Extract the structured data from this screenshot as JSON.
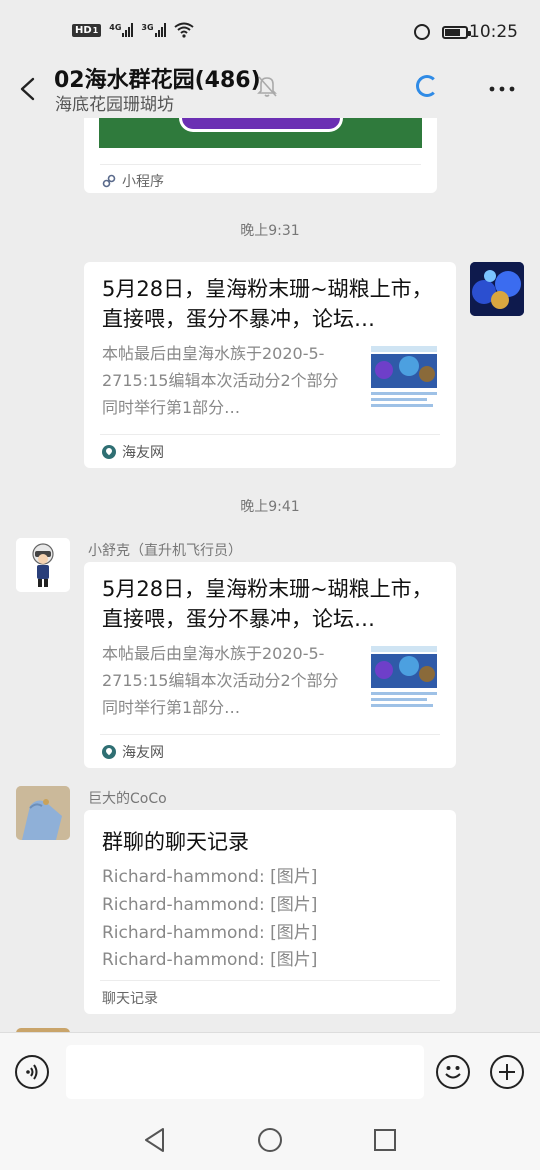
{
  "status_bar": {
    "hd_label": "HD",
    "hd_sub": "1",
    "sig1_label": "4G",
    "sig2_label": "3G",
    "battery_percent": 75,
    "time": "10:25"
  },
  "header": {
    "title": "02海水群花园(486)",
    "subtitle": "海底花园珊瑚坊"
  },
  "messages": [
    {
      "type": "mini-program-tail",
      "source": "小程序"
    },
    {
      "type": "timestamp",
      "text": "晚上9:31"
    },
    {
      "type": "link",
      "side": "right",
      "title": "5月28日，皇海粉末珊~瑚粮上市，直接喂，蛋分不暴冲，论坛…",
      "desc": "本帖最后由皇海水族于2020-5-2715:15编辑本次活动分2个部分同时举行第1部分…",
      "source": "海友网"
    },
    {
      "type": "timestamp",
      "text": "晚上9:41"
    },
    {
      "type": "link",
      "side": "left",
      "sender": "小舒克（直升机飞行员）",
      "title": "5月28日，皇海粉末珊~瑚粮上市，直接喂，蛋分不暴冲，论坛…",
      "desc": "本帖最后由皇海水族于2020-5-2715:15编辑本次活动分2个部分同时举行第1部分…",
      "source": "海友网"
    },
    {
      "type": "chat-record",
      "side": "left",
      "sender": "巨大的CoCo",
      "title": "群聊的聊天记录",
      "lines": [
        "Richard-hammond: [图片]",
        "Richard-hammond: [图片]",
        "Richard-hammond: [图片]",
        "Richard-hammond: [图片]"
      ],
      "footer": "聊天记录"
    }
  ],
  "input": {
    "placeholder": ""
  },
  "colors": {
    "accent": "#2f8be6",
    "bg": "#ededed"
  }
}
